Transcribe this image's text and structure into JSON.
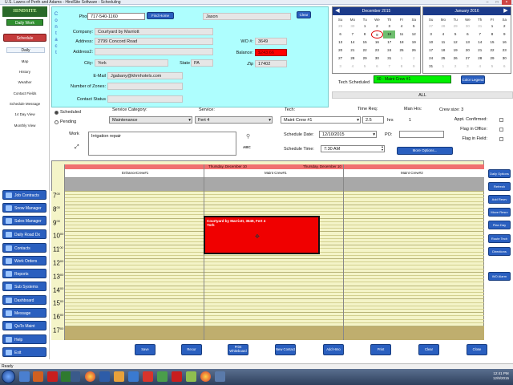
{
  "window": {
    "title": "U.S. Lawns of Perth and Adams - HindSite Software - Scheduling"
  },
  "sidebar": {
    "logo": "HINDSITE SOFTWARE",
    "daily_work": "Daily Work",
    "schedule": "Schedule",
    "daily": "Daily",
    "links": [
      "Map",
      "History",
      "Weather",
      "Contact Fields",
      "Schedule Message",
      "14 Day View",
      "Monthly View"
    ],
    "big_buttons": [
      "Job Contracts",
      "Snow Manager",
      "Sales Manager",
      "Daily Road Dx",
      "Contacts",
      "Work Orders",
      "Reports",
      "Sub Systems",
      "Dashboard",
      "Message",
      "QuTo Maint",
      "Help",
      "Exit"
    ]
  },
  "form": {
    "side_letters": [
      "C",
      "o",
      "n",
      "t",
      "a",
      "c",
      "t"
    ],
    "phone_label": "Phone:",
    "phone_value": "717-540-1160",
    "find_home_button": "Find Home",
    "contact_name": "Jason",
    "clear_button": "Clear",
    "company_label": "Company:",
    "company_value": "Courtyard by Marriott",
    "address_label": "Address:",
    "address_value": "2799 Concord Road",
    "address2_label": "Address2:",
    "address2_value": "",
    "wo_label": "WO #:",
    "wo_value": "3649",
    "balance_label": "Balance:",
    "balance_value": "$243.66",
    "city_label": "City:",
    "city_value": "York",
    "state_label": "State",
    "state_value": "PA",
    "zip_label": "Zip",
    "zip_value": "17402",
    "email_label": "E-Mail",
    "email_value": "Jgabany@khmhotels.com",
    "zones_label": "Number of Zones:",
    "zones_value": "",
    "contact_status_label": "Contact Status",
    "contact_status_value": ""
  },
  "calendar_left": {
    "month": "December 2015",
    "days": [
      "Su",
      "Mo",
      "Tu",
      "We",
      "Th",
      "Fr",
      "Sa"
    ],
    "weeks": [
      [
        "29",
        "30",
        "1",
        "2",
        "3",
        "4",
        "5"
      ],
      [
        "6",
        "7",
        "8",
        "9",
        "10",
        "11",
        "12"
      ],
      [
        "13",
        "14",
        "15",
        "16",
        "17",
        "18",
        "19"
      ],
      [
        "20",
        "21",
        "22",
        "23",
        "24",
        "25",
        "26"
      ],
      [
        "27",
        "28",
        "29",
        "30",
        "31",
        "1",
        "2"
      ],
      [
        "3",
        "4",
        "5",
        "6",
        "7",
        "8",
        "9"
      ]
    ],
    "today": "9",
    "selected": "10"
  },
  "calendar_right": {
    "month": "January 2016",
    "days": [
      "Su",
      "Mo",
      "Tu",
      "We",
      "Th",
      "Fr",
      "Sa"
    ],
    "weeks": [
      [
        "27",
        "28",
        "29",
        "30",
        "31",
        "1",
        "2"
      ],
      [
        "3",
        "4",
        "5",
        "6",
        "7",
        "8",
        "9"
      ],
      [
        "10",
        "11",
        "12",
        "13",
        "14",
        "15",
        "16"
      ],
      [
        "17",
        "18",
        "19",
        "20",
        "21",
        "22",
        "23"
      ],
      [
        "24",
        "25",
        "26",
        "27",
        "28",
        "29",
        "30"
      ],
      [
        "31",
        "1",
        "2",
        "3",
        "4",
        "5",
        "6"
      ]
    ]
  },
  "tech_sched": {
    "label": "Tech Scheduled",
    "value": "00 - Maint Crew #1",
    "color_legend": "Color Legend",
    "all": "ALL"
  },
  "service": {
    "scheduled": "Scheduled",
    "pending": "Pending",
    "category_label": "Service Category:",
    "category_value": "Maintenance",
    "service_label": "Service:",
    "service_value": "Fert 4",
    "tech_label": "Tech:",
    "tech_value": "Maint Crew #1",
    "time_req_label": "Time Req:",
    "time_req_value": "2.5",
    "hrs": "hrs",
    "man_hrs_label": "Man Hrs:",
    "man_hrs_value": "1",
    "crew_size": "Crew size: 3",
    "appt_confirmed": "Appt. Confirmed:",
    "flag_office": "Flag in Office:",
    "flag_field": "Flag in Field:",
    "work_label": "Work",
    "work_value": "Irrigation repair",
    "schedule_date_label": "Schedule Date:",
    "schedule_date_value": "12/10/2015",
    "po_label": "PO:",
    "schedule_time_label": "Schedule Time:",
    "schedule_time_value": "7:30 AM",
    "more_options": "More Options..."
  },
  "schedule": {
    "day_left": "Thursday, December 10",
    "day_right": "Thursday, December 10",
    "crews": [
      "EnhanceCrew#1",
      "Maint Crew#1",
      "Maint Crew#2"
    ],
    "hours": [
      "7",
      "8",
      "9",
      "10",
      "11",
      "12",
      "13",
      "14",
      "15",
      "16",
      "17"
    ],
    "hour_suffix": "00",
    "appointment_line1": "Courtyard by Marriott, 3649, Fert 4",
    "appointment_line2": "York"
  },
  "bottom_buttons": [
    "Save",
    "Recur",
    "Print Whiteboard",
    "New Contact",
    "Add Hmo",
    "Print",
    "Clear",
    "Close"
  ],
  "right_buttons": [
    "Daily Options",
    "Refresh",
    "Add Resrv",
    "Move Resrv",
    "Plan Day",
    "Route Tech",
    "Directions",
    "WO Alarm"
  ],
  "status": "Ready",
  "clock": {
    "time": "12:41 PM",
    "date": "12/9/2015"
  },
  "colors": {
    "form_bg": "#aefefe",
    "accent": "#2a5fbf",
    "appointment": "#f00000",
    "balance": "#ff0000"
  }
}
